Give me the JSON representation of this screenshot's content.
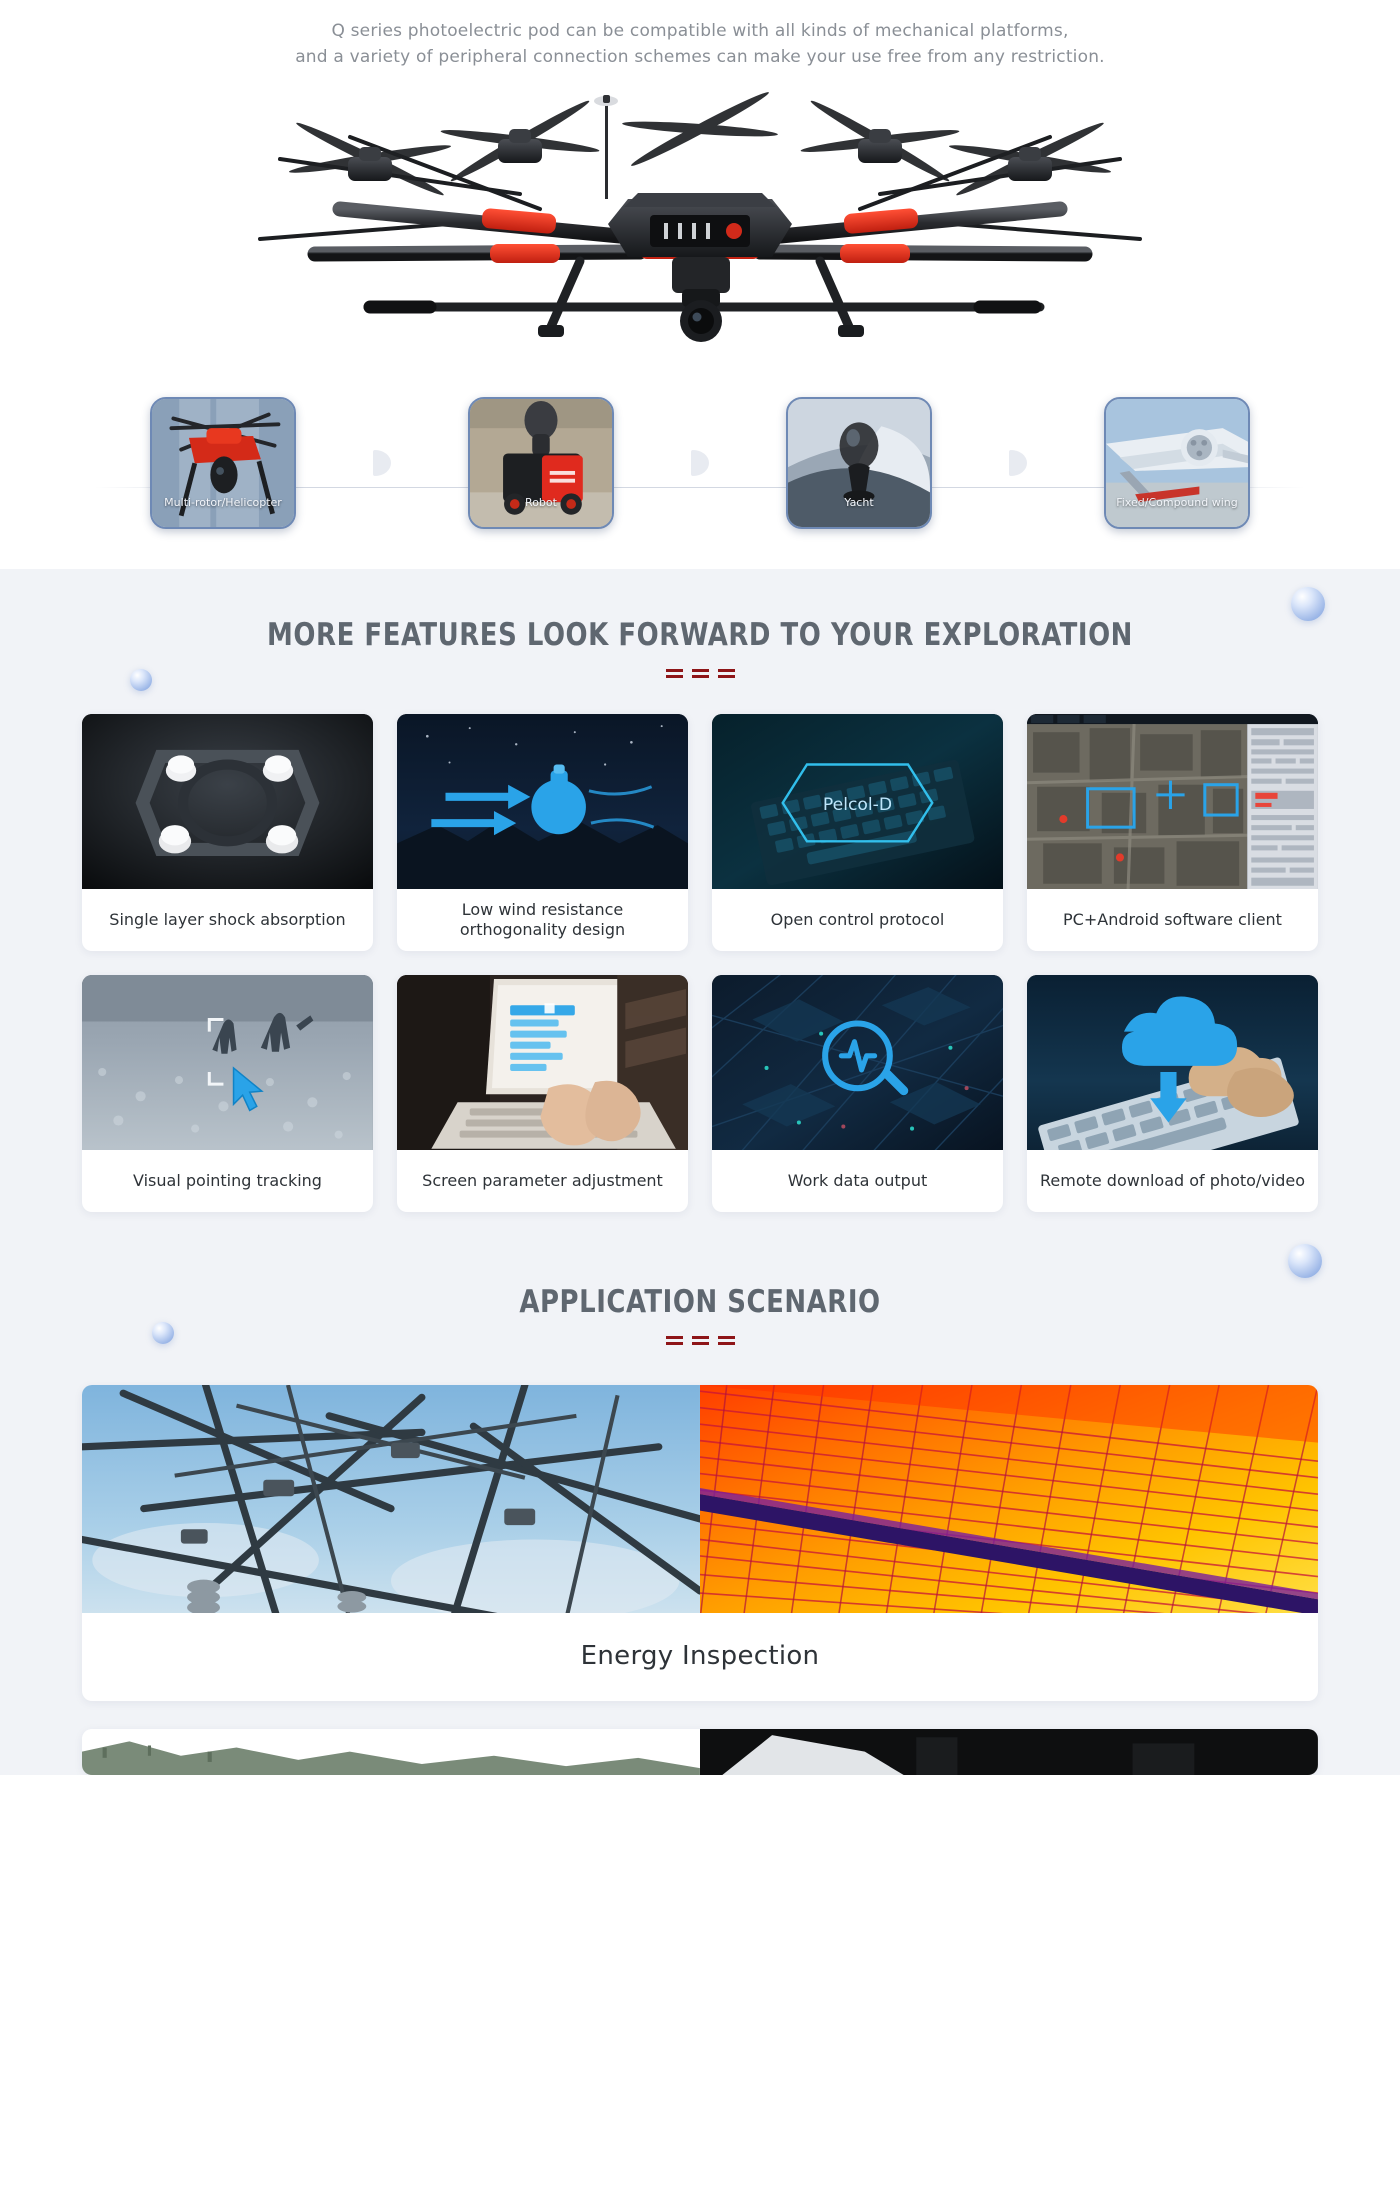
{
  "intro": {
    "line1": "Q series photoelectric pod can be compatible with all kinds of mechanical platforms,",
    "line2": "and a variety of peripheral connection schemes can make your use free from any restriction."
  },
  "hero": {
    "image_name": "multirotor-drone-with-gimbal-pod"
  },
  "platforms": {
    "items": [
      {
        "label": "Multi-rotor/Helicopter",
        "image_name": "red-multirotor-drone-thumb"
      },
      {
        "label": "Robot",
        "image_name": "delivery-robot-thumb"
      },
      {
        "label": "Yacht",
        "image_name": "yacht-mounted-pod-thumb"
      },
      {
        "label": "Fixed/Compound wing",
        "image_name": "fixed-wing-aircraft-thumb"
      }
    ],
    "connector_icon": "arrow-chevron-icon"
  },
  "features": {
    "title": "MORE FEATURES LOOK FORWARD TO YOUR EXPLORATION",
    "divider": "===",
    "cards": [
      {
        "label": "Single layer shock absorption",
        "image_name": "damping-plate-photo"
      },
      {
        "label": "Low wind resistance orthogonality design",
        "image_name": "wind-flow-diagram"
      },
      {
        "label": "Open control protocol",
        "image_name": "protocol-hexagon-graphic",
        "overlay_text": "Pelcol-D"
      },
      {
        "label": "PC+Android software client",
        "image_name": "software-client-screenshot"
      },
      {
        "label": "Visual pointing tracking",
        "image_name": "tracking-crosshair-photo"
      },
      {
        "label": "Screen parameter adjustment",
        "image_name": "laptop-parameter-ui-photo"
      },
      {
        "label": "Work data output",
        "image_name": "data-analytics-graphic"
      },
      {
        "label": "Remote download of photo/video",
        "image_name": "cloud-download-graphic"
      }
    ]
  },
  "applications": {
    "title": "APPLICATION SCENARIO",
    "divider": "===",
    "items": [
      {
        "label": "Energy Inspection",
        "image_left_name": "power-transmission-tower-photo",
        "image_right_name": "solar-panel-thermal-image"
      },
      {
        "label": "",
        "image_left_name": "field-landscape-photo",
        "image_right_name": "dark-inspection-photo"
      }
    ]
  },
  "colors": {
    "section_bg": "#f1f3f7",
    "heading": "#5f6770",
    "divider_red": "#8e1518",
    "card_bg": "#ffffff",
    "body_text": "#2e3338",
    "intro_text": "#8a8f96",
    "accent_blue": "#2aa3e8",
    "platform_border": "#6e89b5"
  }
}
